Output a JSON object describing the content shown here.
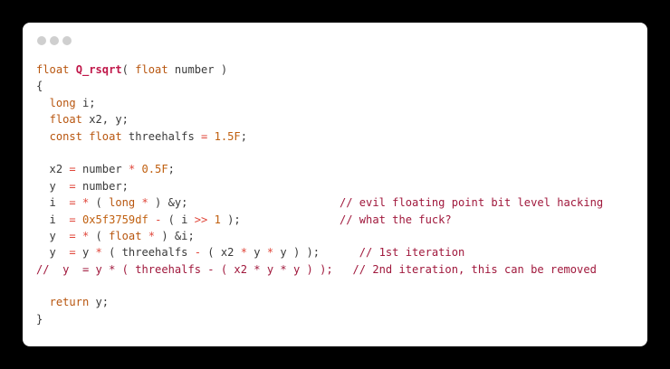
{
  "window": {
    "dot_color": "#cfcfcf",
    "background": "#ffffff"
  },
  "code_lines": [
    [
      {
        "t": "kw",
        "v": "float"
      },
      {
        "t": "txt",
        "v": " "
      },
      {
        "t": "fn",
        "v": "Q_rsqrt"
      },
      {
        "t": "txt",
        "v": "( "
      },
      {
        "t": "kw",
        "v": "float"
      },
      {
        "t": "txt",
        "v": " number )"
      }
    ],
    [
      {
        "t": "txt",
        "v": "{"
      }
    ],
    [
      {
        "t": "txt",
        "v": "  "
      },
      {
        "t": "kw",
        "v": "long"
      },
      {
        "t": "txt",
        "v": " i;"
      }
    ],
    [
      {
        "t": "txt",
        "v": "  "
      },
      {
        "t": "kw",
        "v": "float"
      },
      {
        "t": "txt",
        "v": " x2, y;"
      }
    ],
    [
      {
        "t": "txt",
        "v": "  "
      },
      {
        "t": "kw",
        "v": "const"
      },
      {
        "t": "txt",
        "v": " "
      },
      {
        "t": "kw",
        "v": "float"
      },
      {
        "t": "txt",
        "v": " threehalfs "
      },
      {
        "t": "op",
        "v": "="
      },
      {
        "t": "txt",
        "v": " "
      },
      {
        "t": "num",
        "v": "1.5F"
      },
      {
        "t": "txt",
        "v": ";"
      }
    ],
    [],
    [
      {
        "t": "txt",
        "v": "  x2 "
      },
      {
        "t": "op",
        "v": "="
      },
      {
        "t": "txt",
        "v": " number "
      },
      {
        "t": "op",
        "v": "*"
      },
      {
        "t": "txt",
        "v": " "
      },
      {
        "t": "num",
        "v": "0.5F"
      },
      {
        "t": "txt",
        "v": ";"
      }
    ],
    [
      {
        "t": "txt",
        "v": "  y  "
      },
      {
        "t": "op",
        "v": "="
      },
      {
        "t": "txt",
        "v": " number;"
      }
    ],
    [
      {
        "t": "txt",
        "v": "  i  "
      },
      {
        "t": "op",
        "v": "="
      },
      {
        "t": "txt",
        "v": " "
      },
      {
        "t": "op",
        "v": "*"
      },
      {
        "t": "txt",
        "v": " ( "
      },
      {
        "t": "kw",
        "v": "long"
      },
      {
        "t": "txt",
        "v": " "
      },
      {
        "t": "op",
        "v": "*"
      },
      {
        "t": "txt",
        "v": " ) &y;                       "
      },
      {
        "t": "cmt",
        "v": "// evil floating point bit level hacking"
      }
    ],
    [
      {
        "t": "txt",
        "v": "  i  "
      },
      {
        "t": "op",
        "v": "="
      },
      {
        "t": "txt",
        "v": " "
      },
      {
        "t": "num",
        "v": "0x5f3759df"
      },
      {
        "t": "txt",
        "v": " "
      },
      {
        "t": "op",
        "v": "-"
      },
      {
        "t": "txt",
        "v": " ( i "
      },
      {
        "t": "op",
        "v": ">>"
      },
      {
        "t": "txt",
        "v": " "
      },
      {
        "t": "num",
        "v": "1"
      },
      {
        "t": "txt",
        "v": " );               "
      },
      {
        "t": "cmt",
        "v": "// what the fuck?"
      }
    ],
    [
      {
        "t": "txt",
        "v": "  y  "
      },
      {
        "t": "op",
        "v": "="
      },
      {
        "t": "txt",
        "v": " "
      },
      {
        "t": "op",
        "v": "*"
      },
      {
        "t": "txt",
        "v": " ( "
      },
      {
        "t": "kw",
        "v": "float"
      },
      {
        "t": "txt",
        "v": " "
      },
      {
        "t": "op",
        "v": "*"
      },
      {
        "t": "txt",
        "v": " ) &i;"
      }
    ],
    [
      {
        "t": "txt",
        "v": "  y  "
      },
      {
        "t": "op",
        "v": "="
      },
      {
        "t": "txt",
        "v": " y "
      },
      {
        "t": "op",
        "v": "*"
      },
      {
        "t": "txt",
        "v": " ( threehalfs "
      },
      {
        "t": "op",
        "v": "-"
      },
      {
        "t": "txt",
        "v": " ( x2 "
      },
      {
        "t": "op",
        "v": "*"
      },
      {
        "t": "txt",
        "v": " y "
      },
      {
        "t": "op",
        "v": "*"
      },
      {
        "t": "txt",
        "v": " y ) );      "
      },
      {
        "t": "cmt",
        "v": "// 1st iteration"
      }
    ],
    [
      {
        "t": "cmt",
        "v": "//  y  = y * ( threehalfs - ( x2 * y * y ) );   // 2nd iteration, this can be removed"
      }
    ],
    [],
    [
      {
        "t": "txt",
        "v": "  "
      },
      {
        "t": "kw",
        "v": "return"
      },
      {
        "t": "txt",
        "v": " y;"
      }
    ],
    [
      {
        "t": "txt",
        "v": "}"
      }
    ]
  ]
}
